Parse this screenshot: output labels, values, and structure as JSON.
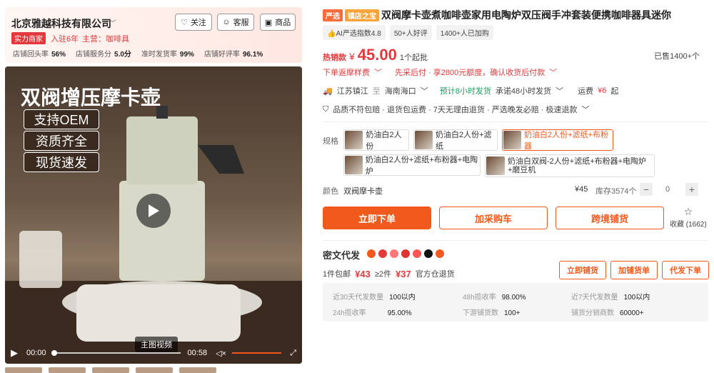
{
  "shop": {
    "name": "北京雅越科技有限公司",
    "follow": "关注",
    "service": "客服",
    "store": "商品",
    "badge": "实力商家",
    "years": "入驻6年",
    "main": "主营：咖啡具",
    "stats": [
      {
        "label": "店铺回头率",
        "value": "56%"
      },
      {
        "label": "店铺服务分",
        "value": "5.0分"
      },
      {
        "label": "准时发货率",
        "value": "99%"
      },
      {
        "label": "店铺好评率",
        "value": "96.1%"
      }
    ]
  },
  "video": {
    "title": "双阀增压摩卡壶",
    "pills": [
      "支持OEM",
      "资质齐全",
      "现货速发"
    ],
    "main_label": "主图视频",
    "current": "00:00",
    "duration": "00:58"
  },
  "product": {
    "tag1": "严选",
    "tag2": "镇店之宝",
    "title": "双阀摩卡壶煮咖啡壶家用电陶炉双压阀手冲套装便携咖啡器具迷你",
    "ai_index": "AI严选指数4.8",
    "good_reviews": "50+人好评",
    "purchased": "1400+人已加购",
    "price_label": "热销款",
    "price": "45.00",
    "currency": "¥",
    "min_order": "1个起批",
    "sold": "已售1400+个",
    "coupon": "下单返摩样费",
    "credit": "先采后付 · 享2800元额度，确认收货后付款",
    "ship_from": "江苏镇江",
    "ship_to": "海南海口",
    "ship_time": "预计8小时发货",
    "ship_promise": "承诺48小时发货",
    "freight_label": "运费",
    "freight": "¥6",
    "freight_suffix": "起",
    "policies": "品质不符包赔 · 退货包运费 · 7天无理由退货 · 严选晚发必赔 · 极速退款",
    "spec_label": "规格",
    "specs": [
      "奶油白2人份",
      "奶油白2人份+滤纸",
      "奶油白2人份+滤纸+布粉器",
      "奶油白2人份+滤纸+布粉器+电陶炉",
      "奶油白双阀-2人份+滤纸+布粉器+电陶炉+磨豆机"
    ],
    "color_label": "颜色",
    "color_value": "双阀摩卡壶",
    "unit_price": "¥45",
    "stock": "库存3574个",
    "qty": "0",
    "buy": "立即下单",
    "cart": "加采购车",
    "cross": "跨境铺货",
    "fav": "收藏",
    "fav_count": "(1662)"
  },
  "dropship": {
    "title": "密文代发",
    "free_ship": "1件包邮",
    "price1": "¥43",
    "tier2": "≥2件",
    "price2": "¥37",
    "refund": "官方仓退货",
    "btn1": "立即铺货",
    "btn2": "加铺货单",
    "btn3": "代发下单",
    "grid": [
      {
        "label": "近30天代发数量",
        "value": "100以内"
      },
      {
        "label": "48h揽收率",
        "value": "98.00%"
      },
      {
        "label": "近7天代发数量",
        "value": "100以内"
      },
      {
        "label": "24h揽收率",
        "value": "95.00%"
      },
      {
        "label": "下游铺货数",
        "value": "100+"
      },
      {
        "label": "铺货分销商数",
        "value": "60000+"
      }
    ]
  },
  "colors": {
    "accent": "#f25a1d",
    "red": "#e4393c"
  }
}
